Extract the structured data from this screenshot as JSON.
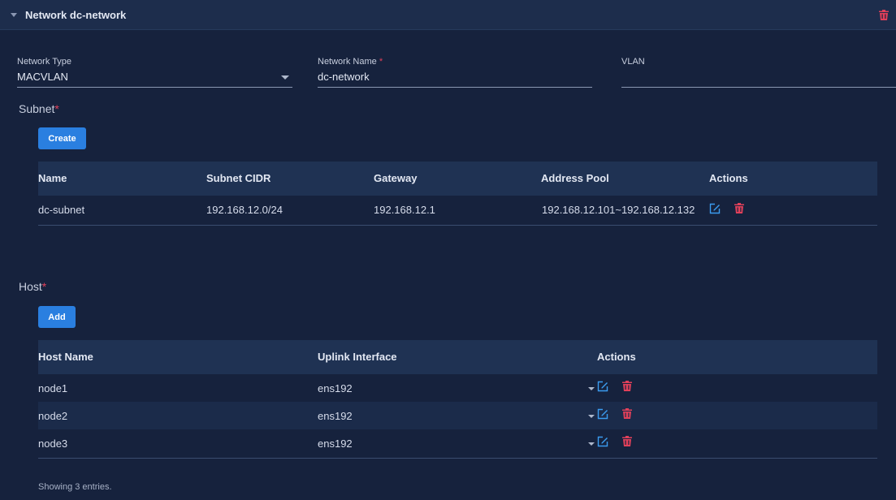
{
  "header": {
    "title": "Network dc-network"
  },
  "form": {
    "network_type": {
      "label": "Network Type",
      "value": "MACVLAN"
    },
    "network_name": {
      "label": "Network Name",
      "required_mark": "*",
      "value": "dc-network"
    },
    "vlan": {
      "label": "VLAN",
      "value": ""
    }
  },
  "subnet": {
    "title": "Subnet",
    "required_mark": "*",
    "create_label": "Create",
    "columns": [
      "Name",
      "Subnet CIDR",
      "Gateway",
      "Address Pool",
      "Actions"
    ],
    "rows": [
      {
        "name": "dc-subnet",
        "cidr": "192.168.12.0/24",
        "gateway": "192.168.12.1",
        "pool": "192.168.12.101~192.168.12.132"
      }
    ]
  },
  "host": {
    "title": "Host",
    "required_mark": "*",
    "add_label": "Add",
    "columns": [
      "Host Name",
      "Uplink Interface",
      "Actions"
    ],
    "rows": [
      {
        "name": "node1",
        "uplink": "ens192"
      },
      {
        "name": "node2",
        "uplink": "ens192"
      },
      {
        "name": "node3",
        "uplink": "ens192"
      }
    ],
    "footer": "Showing 3 entries."
  },
  "colors": {
    "accent": "#2a7fe0",
    "danger": "#e0405a",
    "edit": "#3b9cf0",
    "background": "#16223d"
  },
  "icons": {
    "delete": "trash-icon",
    "edit": "edit-icon",
    "collapse": "caret-down-icon"
  }
}
